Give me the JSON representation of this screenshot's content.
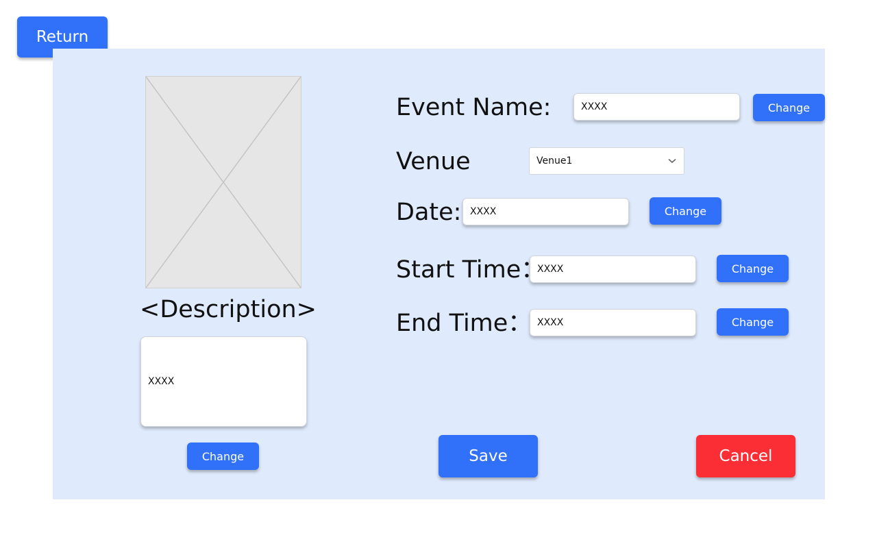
{
  "return_label": "Return",
  "description": {
    "heading": "<Description>",
    "value": "XXXX",
    "change_label": "Change"
  },
  "form": {
    "event_name": {
      "label": "Event Name:",
      "value": "XXXX",
      "change_label": "Change"
    },
    "venue": {
      "label": "Venue",
      "selected": "Venue1"
    },
    "date": {
      "label": "Date:",
      "value": "XXXX",
      "change_label": "Change"
    },
    "start_time": {
      "label": "Start Time：",
      "value": "XXXX",
      "change_label": "Change"
    },
    "end_time": {
      "label": "End Time：",
      "value": "XXXX",
      "change_label": "Change"
    }
  },
  "actions": {
    "save_label": "Save",
    "cancel_label": "Cancel"
  },
  "icons": {
    "image": "image-placeholder-icon",
    "dropdown": "chevron-down-icon"
  },
  "colors": {
    "panel": "#dfeafc",
    "primary": "#3171fa",
    "danger": "#fb2d35"
  }
}
